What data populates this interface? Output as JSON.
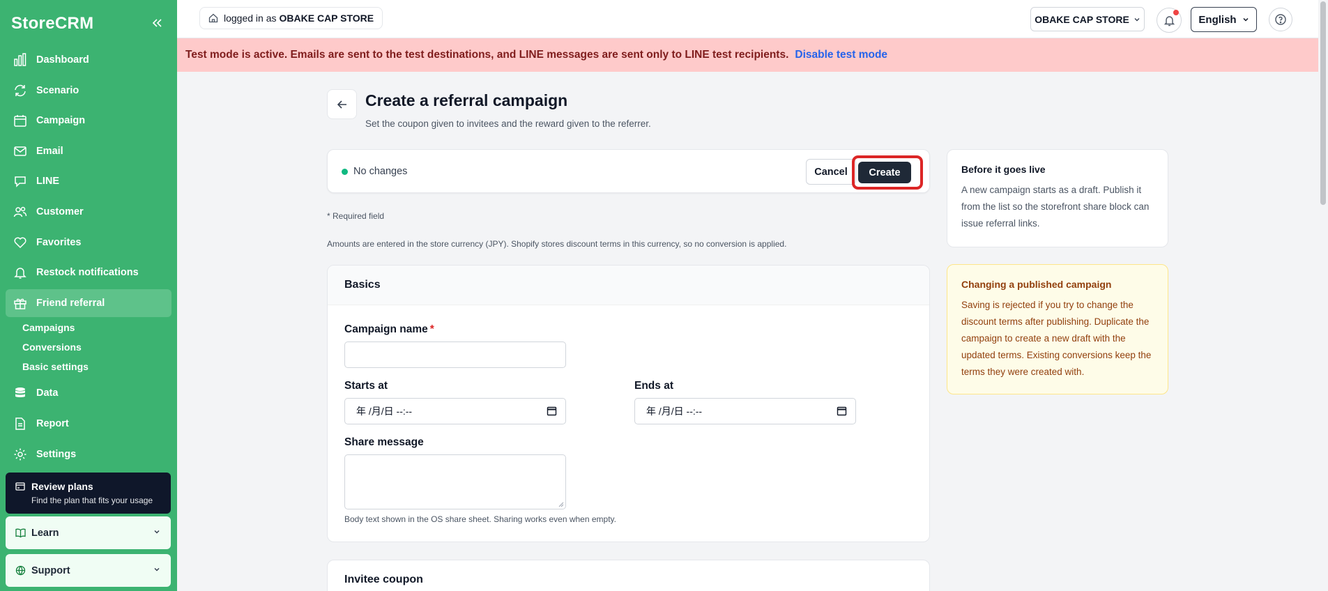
{
  "app": {
    "brand": "StoreCRM"
  },
  "sidebar": {
    "items": [
      {
        "label": "Dashboard",
        "icon": "chart-bars-icon"
      },
      {
        "label": "Scenario",
        "icon": "refresh-icon"
      },
      {
        "label": "Campaign",
        "icon": "calendar-icon"
      },
      {
        "label": "Email",
        "icon": "mail-icon"
      },
      {
        "label": "LINE",
        "icon": "chat-icon"
      },
      {
        "label": "Customer",
        "icon": "users-icon"
      },
      {
        "label": "Favorites",
        "icon": "heart-icon"
      },
      {
        "label": "Restock notifications",
        "icon": "bell-icon"
      },
      {
        "label": "Friend referral",
        "icon": "gift-icon"
      }
    ],
    "subitems": [
      "Campaigns",
      "Conversions",
      "Basic settings"
    ],
    "items_after": [
      {
        "label": "Data",
        "icon": "database-icon"
      },
      {
        "label": "Report",
        "icon": "file-icon"
      },
      {
        "label": "Settings",
        "icon": "gear-icon"
      }
    ],
    "review": {
      "title": "Review plans",
      "subtitle": "Find the plan that fits your usage"
    },
    "learn": "Learn",
    "support": "Support"
  },
  "topbar": {
    "logged_prefix": "logged in as",
    "store_name": "OBAKE CAP STORE",
    "store_select": "OBAKE CAP STORE",
    "language": "English"
  },
  "banner": {
    "text": "Test mode is active. Emails are sent to the test destinations, and LINE messages are sent only to LINE test recipients.",
    "link": "Disable test mode"
  },
  "page": {
    "title": "Create a referral campaign",
    "subtitle": "Set the coupon given to invitees and the reward given to the referrer.",
    "status": "No changes",
    "cancel": "Cancel",
    "create": "Create",
    "required_note": "* Required field",
    "amount_note": "Amounts are entered in the store currency (JPY). Shopify stores discount terms in this currency, so no conversion is applied."
  },
  "basics": {
    "heading": "Basics",
    "campaign_name_label": "Campaign name",
    "required_star": "*",
    "campaign_name_value": "",
    "starts_label": "Starts at",
    "starts_value": "年 /月/日 --:--",
    "ends_label": "Ends at",
    "ends_value": "年 /月/日 --:--",
    "share_label": "Share message",
    "share_value": "",
    "share_hint": "Body text shown in the OS share sheet. Sharing works even when empty."
  },
  "invitee": {
    "heading": "Invitee coupon"
  },
  "side": {
    "live": {
      "title": "Before it goes live",
      "body": "A new campaign starts as a draft. Publish it from the list so the storefront share block can issue referral links."
    },
    "published": {
      "title": "Changing a published campaign",
      "body": "Saving is rejected if you try to change the discount terms after publishing. Duplicate the campaign to create a new draft with the updated terms. Existing conversions keep the terms they were created with."
    }
  }
}
